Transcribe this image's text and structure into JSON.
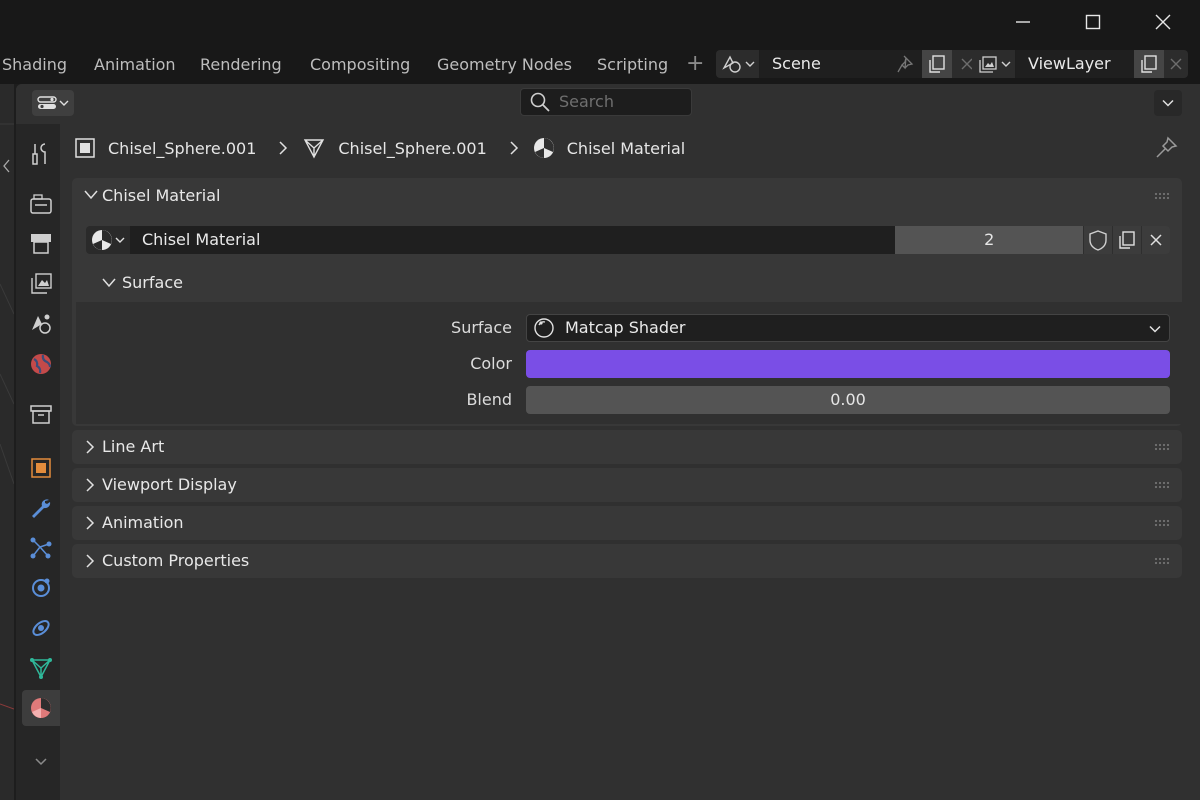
{
  "workspace_tabs": [
    "Shading",
    "Animation",
    "Rendering",
    "Compositing",
    "Geometry Nodes",
    "Scripting"
  ],
  "scene": {
    "name": "Scene"
  },
  "view_layer": {
    "name": "ViewLayer"
  },
  "search": {
    "placeholder": "Search"
  },
  "breadcrumb": {
    "object": "Chisel_Sphere.001",
    "mesh": "Chisel_Sphere.001",
    "material": "Chisel Material"
  },
  "panels": {
    "material": {
      "title": "Chisel Material",
      "material_name": "Chisel Material",
      "users": "2",
      "surface_section": {
        "title": "Surface",
        "surface_label": "Surface",
        "surface_value": "Matcap Shader",
        "color_label": "Color",
        "color_value": "#7a4ee6",
        "blend_label": "Blend",
        "blend_value": "0.00"
      }
    },
    "collapsed": [
      "Line Art",
      "Viewport Display",
      "Animation",
      "Custom Properties"
    ]
  },
  "property_tabs": [
    "tool-icon",
    "render-icon",
    "output-icon",
    "view-layer-icon",
    "scene-icon",
    "world-icon",
    "collection-icon",
    "object-icon",
    "modifier-icon",
    "particles-icon",
    "physics-icon",
    "constraints-icon",
    "data-icon",
    "material-icon"
  ],
  "colors": {
    "accent": "#4772b3",
    "material_color": "#7a4ee6",
    "object_orange": "#e38c3c"
  }
}
